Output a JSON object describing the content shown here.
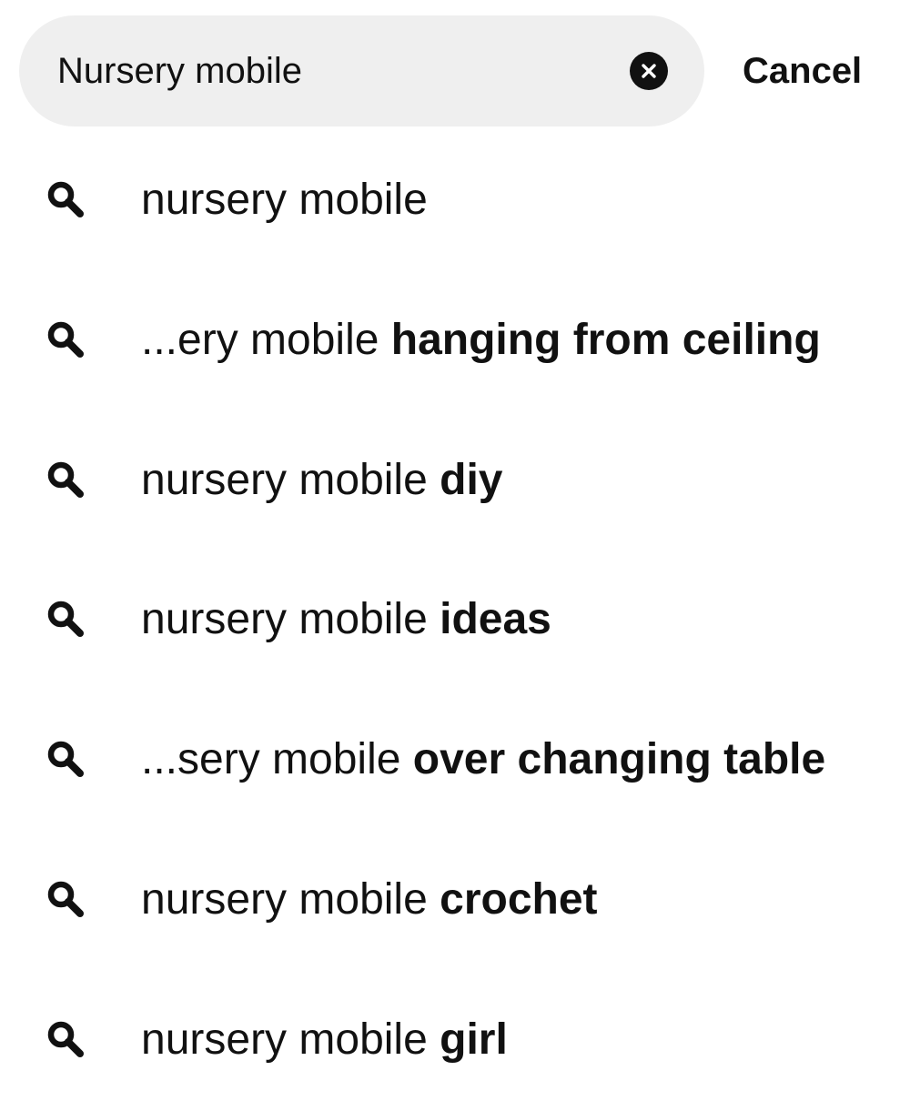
{
  "search": {
    "value": "Nursery mobile",
    "clear_icon": "close-circle-icon",
    "cancel_label": "Cancel"
  },
  "suggestions": [
    {
      "prefix": "nursery mobile",
      "suffix": "",
      "icon": "search-icon"
    },
    {
      "prefix": "...ery mobile ",
      "suffix": "hanging from ceiling",
      "icon": "search-icon"
    },
    {
      "prefix": "nursery mobile ",
      "suffix": "diy",
      "icon": "search-icon"
    },
    {
      "prefix": "nursery mobile ",
      "suffix": "ideas",
      "icon": "search-icon"
    },
    {
      "prefix": "...sery mobile ",
      "suffix": "over changing table",
      "icon": "search-icon"
    },
    {
      "prefix": "nursery mobile ",
      "suffix": "crochet",
      "icon": "search-icon"
    },
    {
      "prefix": "nursery mobile ",
      "suffix": "girl",
      "icon": "search-icon"
    }
  ],
  "colors": {
    "text": "#111111",
    "search_bg": "#efefef",
    "background": "#ffffff"
  }
}
